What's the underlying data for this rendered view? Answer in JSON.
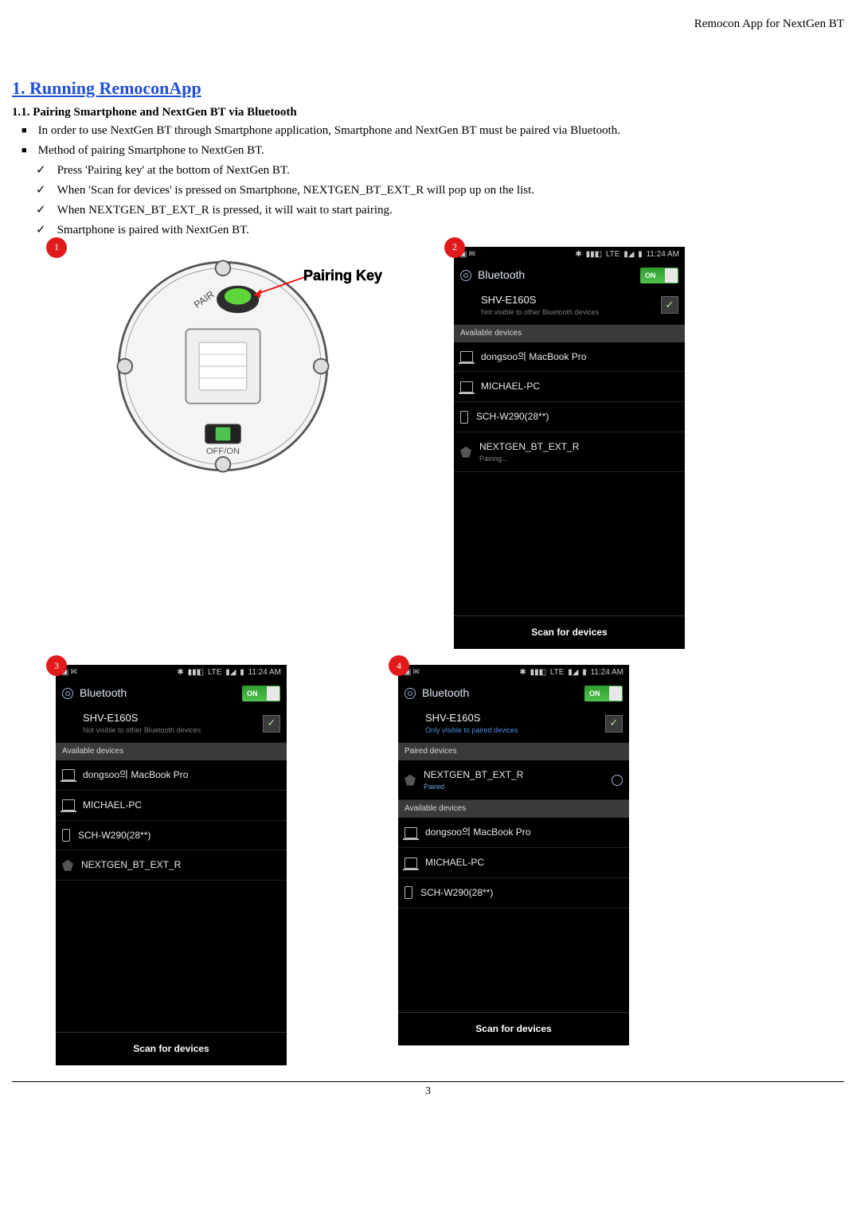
{
  "header": {
    "doc_title": "Remocon App for NextGen BT"
  },
  "section": {
    "number_title": "1. Running RemoconApp",
    "subsection_title": "1.1. Pairing Smartphone and NextGen BT via Bluetooth",
    "bullets": [
      "In order to use NextGen BT through Smartphone application, Smartphone and NextGen BT must be paired via Bluetooth.",
      "Method of pairing Smartphone to NextGen BT."
    ],
    "checks": [
      "Press 'Pairing key' at the bottom of NextGen BT.",
      "When 'Scan for devices' is pressed on Smartphone, NEXTGEN_BT_EXT_R will pop up on the list.",
      "When NEXTGEN_BT_EXT_R is pressed, it will wait to start pairing.",
      "Smartphone is paired with NextGen BT."
    ]
  },
  "badges": {
    "b1": "1",
    "b2": "2",
    "b3": "3",
    "b4": "4"
  },
  "device": {
    "pairing_key_label": "Pairing Key",
    "pair_text": "PAIR",
    "offon_text": "OFF/ON"
  },
  "phone_common": {
    "time": "11:24 AM",
    "lte": "LTE",
    "bt_title": "Bluetooth",
    "toggle": "ON",
    "self_name": "SHV-E160S",
    "available_hdr": "Available devices",
    "paired_hdr": "Paired devices",
    "scan_btn": "Scan for devices",
    "dev_macbook": "dongsoo의 MacBook Pro",
    "dev_michael": "MICHAEL-PC",
    "dev_sch": "SCH-W290(28**)",
    "dev_nextgen": "NEXTGEN_BT_EXT_R",
    "self_sub_notvisible": "Not visible to other Bluetooth devices",
    "self_sub_onlypaired": "Only visible to paired devices",
    "pairing_text": "Pairing...",
    "paired_text": "Paired"
  },
  "page_number": "3"
}
